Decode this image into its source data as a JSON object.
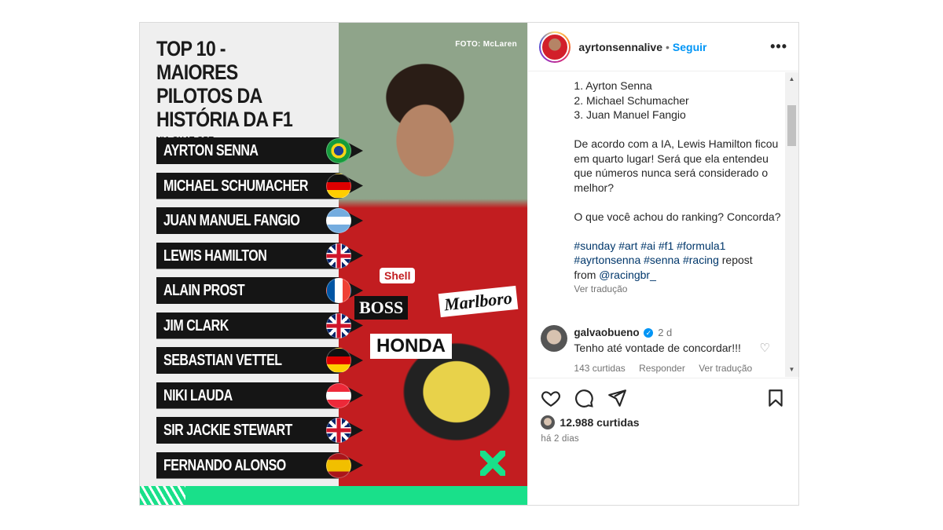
{
  "infographic": {
    "title": "TOP 10 - MAIORES\nPILOTOS DA\nHISTÓRIA DA F1",
    "subtitle": "VIA CHAT GPT",
    "photo_credit": "FOTO: McLaren",
    "accent_color": "#19e08a",
    "suit_text": {
      "boss": "BOSS",
      "honda": "HONDA",
      "marlboro": "Marlboro",
      "shell": "Shell"
    },
    "ranking": [
      {
        "name": "AYRTON SENNA",
        "flag": "br"
      },
      {
        "name": "MICHAEL SCHUMACHER",
        "flag": "de"
      },
      {
        "name": "JUAN MANUEL FANGIO",
        "flag": "ar"
      },
      {
        "name": "LEWIS HAMILTON",
        "flag": "gb"
      },
      {
        "name": "ALAIN PROST",
        "flag": "fr"
      },
      {
        "name": "JIM CLARK",
        "flag": "gb"
      },
      {
        "name": "SEBASTIAN VETTEL",
        "flag": "de"
      },
      {
        "name": "NIKI LAUDA",
        "flag": "at"
      },
      {
        "name": "SIR JACKIE STEWART",
        "flag": "gb"
      },
      {
        "name": "FERNANDO ALONSO",
        "flag": "es"
      }
    ]
  },
  "header": {
    "username": "ayrtonsennalive",
    "separator": "•",
    "follow_label": "Seguir",
    "more_icon": "more-horizontal-icon"
  },
  "caption": {
    "list": "1. Ayrton Senna\n2. Michael Schumacher\n3. Juan Manuel Fangio",
    "paragraph1": "De acordo com a IA, Lewis Hamilton ficou em quarto lugar! Será que ela entendeu que números nunca será considerado o melhor?",
    "paragraph2": "O que você achou do ranking? Concorda?",
    "hashtags_line1": "#sunday #art #ai #f1 #formula1",
    "hashtags_line2": "#ayrtonsenna #senna #racing",
    "repost_text": " repost",
    "from_text": "from ",
    "mention": "@racingbr_",
    "translate_label": "Ver tradução"
  },
  "comment": {
    "username": "galvaobueno",
    "verified_glyph": "✓",
    "time": "2 d",
    "text": "Tenho até vontade de concordar!!!",
    "likes": "143 curtidas",
    "reply_label": "Responder",
    "translate_label": "Ver tradução"
  },
  "scrollbar": {
    "up_glyph": "▲",
    "down_glyph": "▼"
  },
  "actions": {
    "icons": [
      "heart-icon",
      "comment-icon",
      "share-icon",
      "bookmark-icon"
    ]
  },
  "likes": {
    "count": "12.988 curtidas"
  },
  "posted_ago": "há 2 dias",
  "colors": {
    "link_blue": "#0095f6",
    "hashtag": "#00376b",
    "muted": "#737373"
  }
}
